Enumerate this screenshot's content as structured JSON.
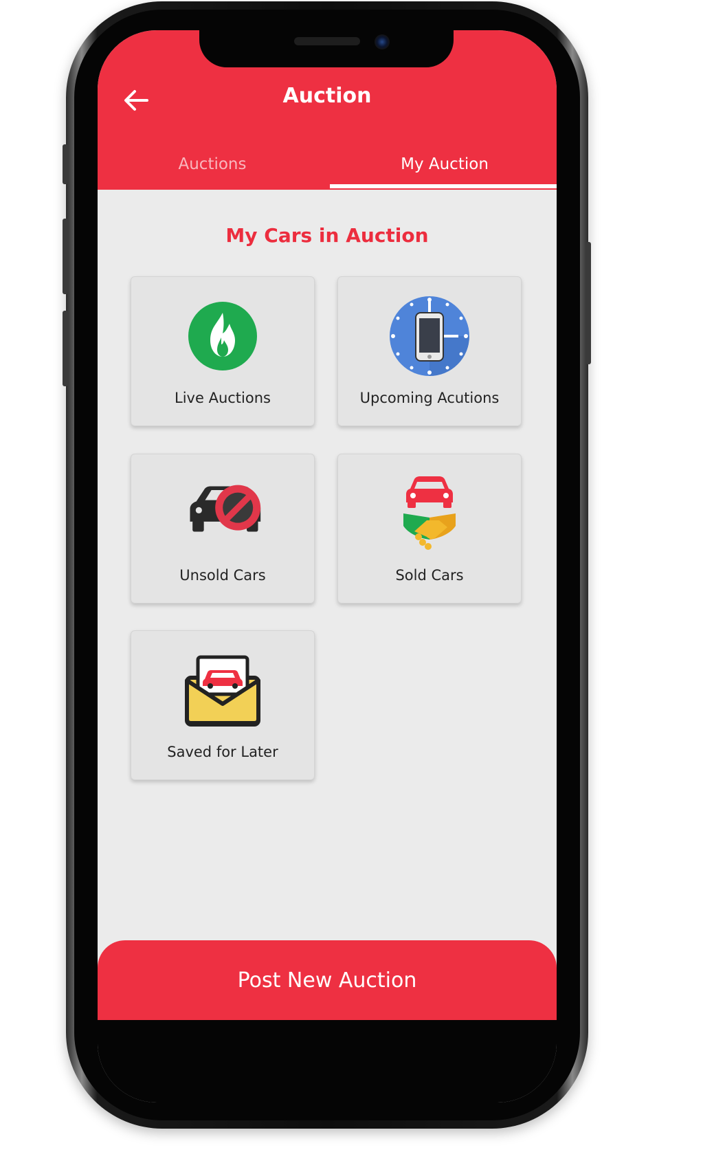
{
  "header": {
    "title": "Auction",
    "back_icon": "arrow-left-icon"
  },
  "tabs": [
    {
      "label": "Auctions",
      "active": false
    },
    {
      "label": "My Auction",
      "active": true
    }
  ],
  "section_title": "My Cars in Auction",
  "tiles": [
    {
      "label": "Live Auctions",
      "icon": "flame-icon"
    },
    {
      "label": "Upcoming Acutions",
      "icon": "phone-clock-icon"
    },
    {
      "label": "Unsold Cars",
      "icon": "car-prohibited-icon"
    },
    {
      "label": "Sold Cars",
      "icon": "car-handshake-icon"
    },
    {
      "label": "Saved for Later",
      "icon": "car-envelope-icon"
    }
  ],
  "footer": {
    "post_button_label": "Post New Auction"
  },
  "colors": {
    "brand_red": "#ee3042",
    "background": "#ebebeb",
    "tile": "#e4e4e4"
  }
}
